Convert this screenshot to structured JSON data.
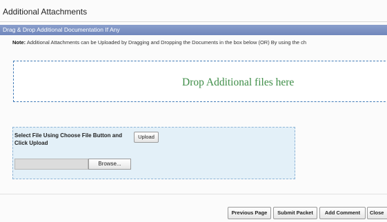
{
  "header": {
    "title": "Additional Attachments"
  },
  "section": {
    "bar_label": "Drag & Drop Additional Documentation If Any"
  },
  "note": {
    "label": "Note:",
    "text": "Additional Attachments can be Uploaded by Dragging and Dropping the Documents in the box below (OR) By using the ch"
  },
  "drop_zone": {
    "text": "Drop Additional files here"
  },
  "upload": {
    "instruction": "Select File Using Choose File Button and Click Upload",
    "upload_label": "Upload",
    "file_value": "",
    "browse_label": "Browse..."
  },
  "footer": {
    "previous_label": "Previous Page",
    "submit_label": "Submit Packet",
    "comment_label": "Add Comment",
    "close_label": "Close"
  },
  "colors": {
    "section_bar": "#7a90c3",
    "drop_border": "#3e79b6",
    "drop_text": "#3e8d47",
    "upload_bg": "#e3f0f8"
  }
}
